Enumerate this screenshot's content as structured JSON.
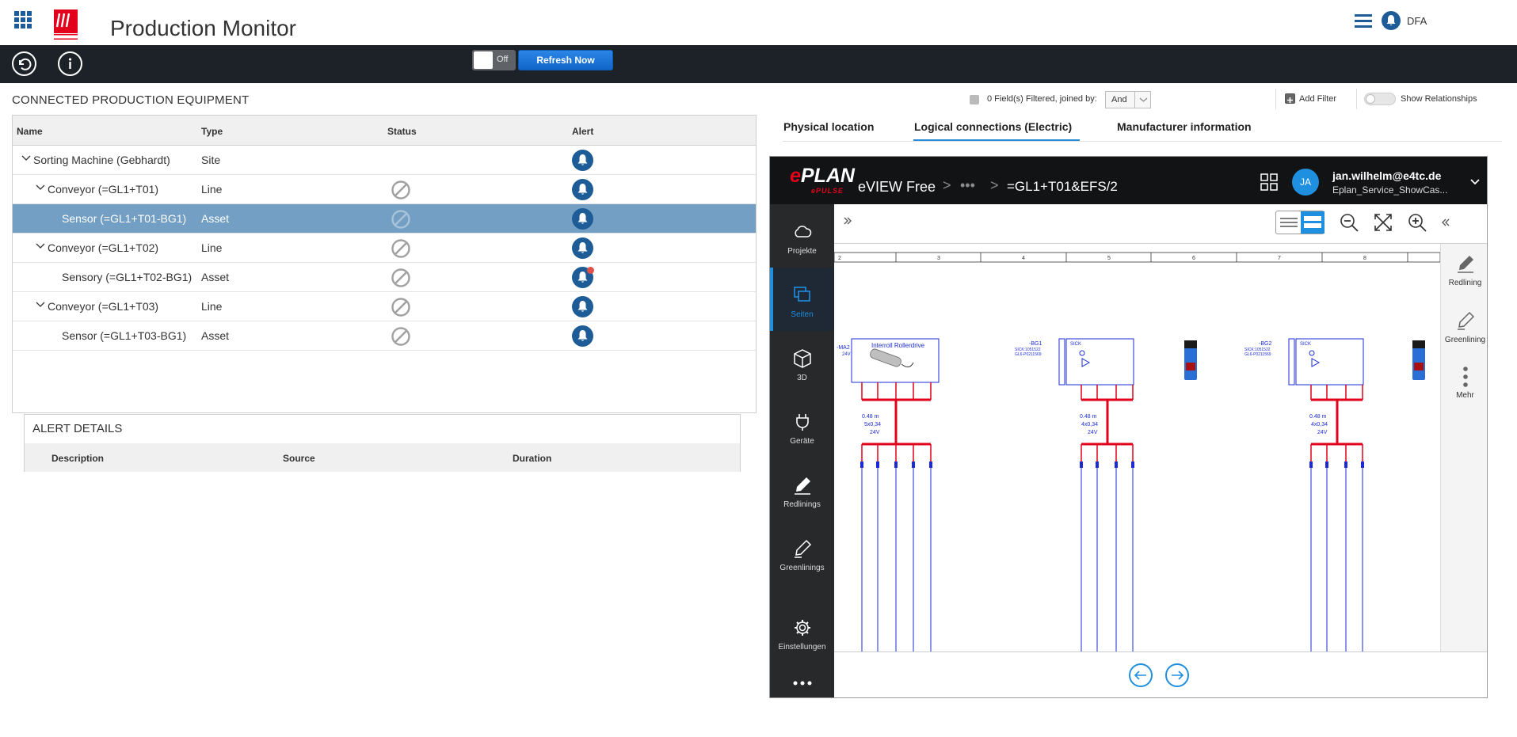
{
  "header": {
    "app_title": "Production Monitor",
    "user_name": "DFA"
  },
  "toolbar": {
    "auto_refresh_toggle": "Off",
    "refresh_label": "Refresh Now"
  },
  "equipment": {
    "section_title": "CONNECTED PRODUCTION EQUIPMENT",
    "columns": [
      "Name",
      "Type",
      "Status",
      "Alert"
    ],
    "rows": [
      {
        "name": "Sorting Machine (Gebhardt)",
        "type": "Site",
        "level": 0,
        "expanded": true,
        "has_status": false,
        "alert_dot": false,
        "selected": false
      },
      {
        "name": "Conveyor (=GL1+T01)",
        "type": "Line",
        "level": 1,
        "expanded": true,
        "has_status": true,
        "alert_dot": false,
        "selected": false
      },
      {
        "name": "Sensor (=GL1+T01-BG1)",
        "type": "Asset",
        "level": 2,
        "expanded": null,
        "has_status": true,
        "alert_dot": false,
        "selected": true
      },
      {
        "name": "Conveyor (=GL1+T02)",
        "type": "Line",
        "level": 1,
        "expanded": true,
        "has_status": true,
        "alert_dot": false,
        "selected": false
      },
      {
        "name": "Sensory (=GL1+T02-BG1)",
        "type": "Asset",
        "level": 2,
        "expanded": null,
        "has_status": true,
        "alert_dot": true,
        "selected": false
      },
      {
        "name": "Conveyor (=GL1+T03)",
        "type": "Line",
        "level": 1,
        "expanded": true,
        "has_status": true,
        "alert_dot": false,
        "selected": false
      },
      {
        "name": "Sensor (=GL1+T03-BG1)",
        "type": "Asset",
        "level": 2,
        "expanded": null,
        "has_status": true,
        "alert_dot": false,
        "selected": false
      }
    ]
  },
  "alert_details": {
    "title": "ALERT DETAILS",
    "columns": [
      "Description",
      "Source",
      "Duration"
    ]
  },
  "filter_bar": {
    "filter_text": "0 Field(s) Filtered, joined by:",
    "join_value": "And",
    "add_filter": "Add Filter",
    "show_relationships": "Show Relationships"
  },
  "tabs": [
    {
      "label": "Physical location",
      "active": false
    },
    {
      "label": "Logical connections (Electric)",
      "active": true
    },
    {
      "label": "Manufacturer information",
      "active": false
    }
  ],
  "viewer": {
    "logo_main": "PLAN",
    "logo_e": "e",
    "logo_sub": "ePULSE",
    "app_name": "eVIEW Free",
    "crumb_sep": ">",
    "crumb_dots": "•••",
    "page_id": "=GL1+T01&EFS/2",
    "avatar": "JA",
    "email": "jan.wilhelm@e4tc.de",
    "project": "Eplan_Service_ShowCas...",
    "sidebar": [
      {
        "label": "Projekte",
        "icon": "cloud-icon",
        "active": false
      },
      {
        "label": "Seiten",
        "icon": "pages-icon",
        "active": true
      },
      {
        "label": "3D",
        "icon": "cube-icon",
        "active": false
      },
      {
        "label": "Geräte",
        "icon": "plug-icon",
        "active": false
      },
      {
        "label": "Redlinings",
        "icon": "marker-icon",
        "active": false
      },
      {
        "label": "Greenlinings",
        "icon": "pen-icon",
        "active": false
      },
      {
        "label": "Einstellungen",
        "icon": "gear-icon",
        "active": false
      }
    ],
    "right_tools": [
      {
        "label": "Redlining"
      },
      {
        "label": "Greenlining"
      },
      {
        "label": "Mehr"
      }
    ],
    "schematic": {
      "ruler": [
        "2",
        "3",
        "4",
        "5",
        "6",
        "7",
        "8"
      ],
      "device1_title": "Interroll Rollerdrive",
      "device1_tag": "-MA2",
      "device1_voltage": "24V",
      "device2_tag": "-BG1",
      "device2_code1": "SICK:1051522",
      "device2_code2": "GL6-P0211569",
      "device3_tag": "-BG2",
      "device3_code1": "SICK:1051522",
      "device3_code2": "GL6-P0211569",
      "cable1": [
        "0.48 m",
        "5x0,34",
        "24V"
      ],
      "cable2": [
        "0.48 m",
        "4x0,34",
        "24V"
      ],
      "cable3": [
        "0.48 m",
        "4x0,34",
        "24V"
      ],
      "brand": "SICK"
    }
  }
}
